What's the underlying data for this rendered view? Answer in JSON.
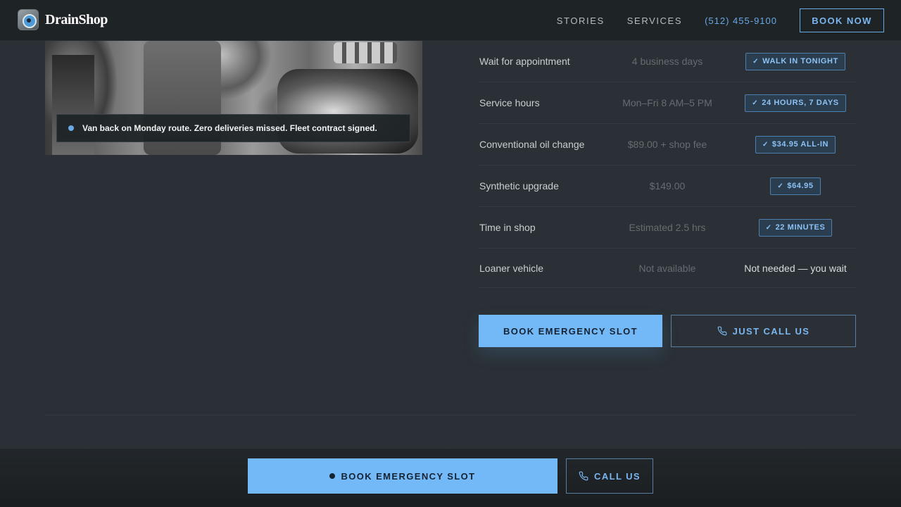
{
  "header": {
    "brand": "DrainShop",
    "nav": {
      "stories": "STORIES",
      "services": "SERVICES",
      "phone": "(512) 455-9100"
    },
    "book_now": "BOOK NOW"
  },
  "photo": {
    "caption": "Van back on Monday route. Zero deliveries missed. Fleet contract signed."
  },
  "comparison": {
    "rows": [
      {
        "label": "Wait for appointment",
        "old": "4 business days",
        "new": "WALK IN TONIGHT"
      },
      {
        "label": "Service hours",
        "old": "Mon–Fri 8 AM–5 PM",
        "new": "24 HOURS, 7 DAYS"
      },
      {
        "label": "Conventional oil change",
        "old": "$89.00 + shop fee",
        "new": "$34.95 ALL-IN"
      },
      {
        "label": "Synthetic upgrade",
        "old": "$149.00",
        "new": "$64.95"
      },
      {
        "label": "Time in shop",
        "old": "Estimated 2.5 hrs",
        "new": "22 MINUTES"
      },
      {
        "label": "Loaner vehicle",
        "old": "Not available",
        "new": "Not needed — you wait"
      }
    ],
    "check_glyph": "✓"
  },
  "cta": {
    "emergency": "BOOK EMERGENCY SLOT",
    "call": "JUST CALL US"
  },
  "sticky": {
    "emergency": "BOOK EMERGENCY SLOT",
    "call": "CALL US"
  },
  "colors": {
    "background": "#2a3035",
    "header": "#1e2326",
    "accent": "#74b9f7",
    "accent_text": "#7ab6f0"
  }
}
